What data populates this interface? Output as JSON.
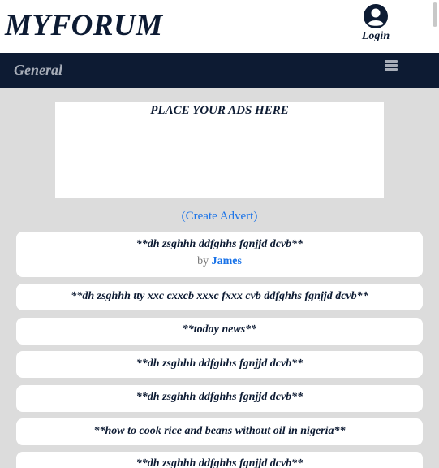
{
  "header": {
    "logo_text": "MYFORUM",
    "login_label": "Login"
  },
  "nav": {
    "title": "General"
  },
  "ads": {
    "placeholder_text": "PLACE YOUR ADS HERE",
    "create_link": "(Create Advert)"
  },
  "posts": [
    {
      "title": "**dh zsghhh ddfghhs fgnjjd dcvb**",
      "by_label": "by",
      "author": "James"
    },
    {
      "title": "**dh zsghhh tty xxc cxxcb xxxc fxxx cvb ddfghhs fgnjjd dcvb**"
    },
    {
      "title": "**today news**"
    },
    {
      "title": "**dh zsghhh ddfghhs fgnjjd dcvb**"
    },
    {
      "title": "**dh zsghhh ddfghhs fgnjjd dcvb**"
    },
    {
      "title": "**how to cook rice and beans without oil in nigeria**"
    },
    {
      "title": "**dh zsghhh ddfghhs fgnjjd dcvb**"
    }
  ],
  "colors": {
    "navy": "#0d1b33",
    "link_blue": "#1a73e8",
    "page_bg": "#dcdcdc"
  },
  "icons": {
    "login": "user-circle-icon",
    "menu": "hamburger-menu-icon"
  }
}
